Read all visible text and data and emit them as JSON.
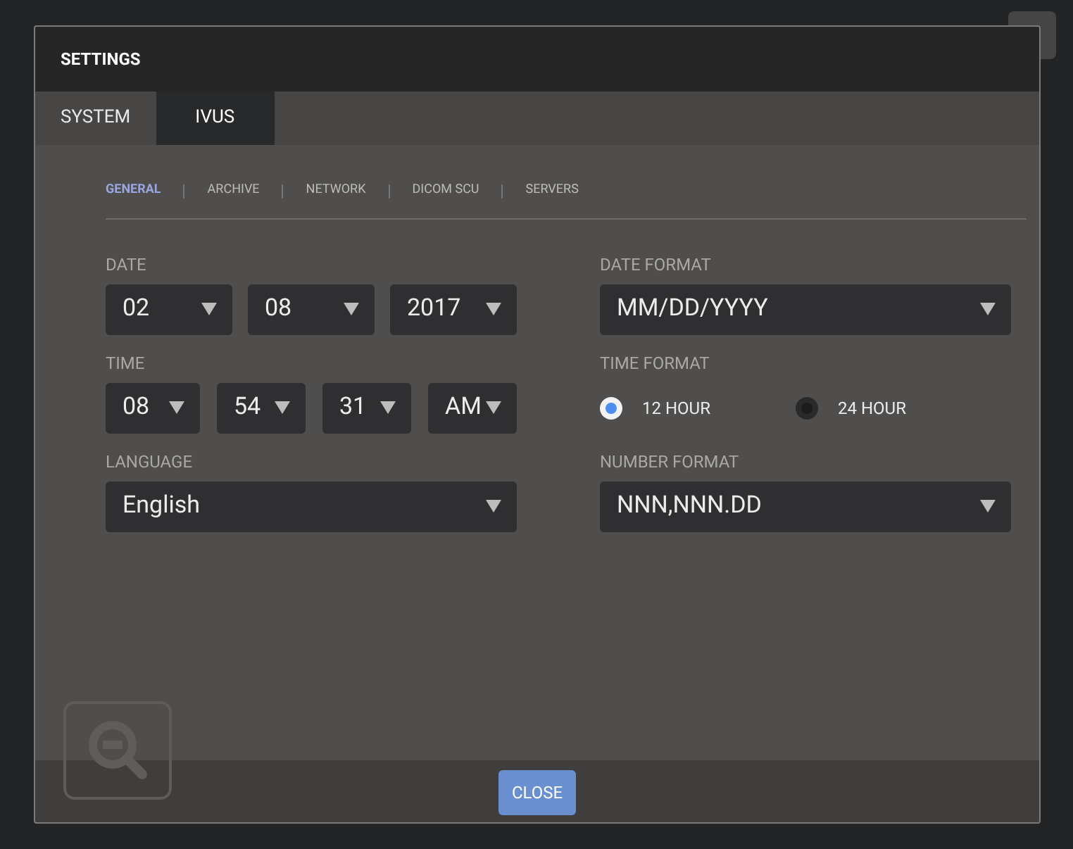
{
  "window": {
    "title": "SETTINGS"
  },
  "tabs": [
    {
      "label": "SYSTEM",
      "selected": false
    },
    {
      "label": "IVUS",
      "selected": true
    }
  ],
  "subtabs": [
    {
      "label": "GENERAL",
      "selected": true
    },
    {
      "label": "ARCHIVE",
      "selected": false
    },
    {
      "label": "NETWORK",
      "selected": false
    },
    {
      "label": "DICOM SCU",
      "selected": false
    },
    {
      "label": "SERVERS",
      "selected": false
    }
  ],
  "date": {
    "label": "DATE",
    "fields": [
      "02",
      "08",
      "2017"
    ]
  },
  "time": {
    "label": "TIME",
    "fields": [
      "08",
      "54",
      "31",
      "AM"
    ]
  },
  "language": {
    "label": "LANGUAGE",
    "value": "English"
  },
  "date_format": {
    "label": "DATE FORMAT",
    "value": "MM/DD/YYYY"
  },
  "time_format": {
    "label": "TIME FORMAT",
    "options": [
      {
        "label": "12 HOUR",
        "selected": true
      },
      {
        "label": "24 HOUR",
        "selected": false
      }
    ]
  },
  "number_format": {
    "label": "NUMBER FORMAT",
    "value": "NNN,NNN.DD"
  },
  "buttons": [
    "CLOSE"
  ]
}
